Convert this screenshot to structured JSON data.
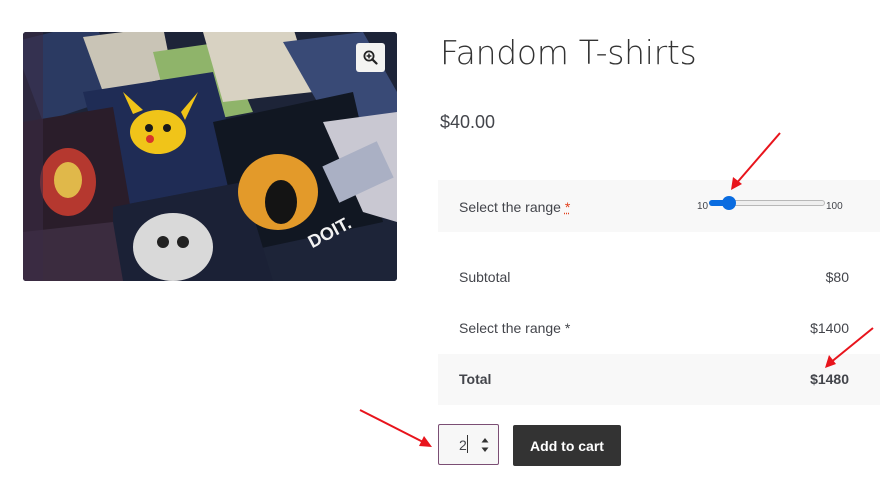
{
  "product": {
    "title": "Fandom T-shirts",
    "price": "$40.00",
    "image_alt": "Pile of printed fandom t-shirts",
    "image_print_text": "DOIT."
  },
  "range_field": {
    "label": "Select the range",
    "required_mark": "*",
    "min_label": "10",
    "max_label": "100",
    "value": 20,
    "min": 10,
    "max": 100
  },
  "totals": [
    {
      "label": "Subtotal",
      "value": "$80"
    },
    {
      "label": "Select the range *",
      "value": "$1400"
    },
    {
      "label": "Total",
      "value": "$1480"
    }
  ],
  "quantity": {
    "value": "2"
  },
  "add_to_cart_label": "Add to cart",
  "icons": {
    "zoom": "zoom-in-icon",
    "annotation": "red-arrow"
  },
  "colors": {
    "accent": "#0a6ce0",
    "button_bg": "#333333",
    "annotation": "#e8141c",
    "required": "#e2401c"
  }
}
